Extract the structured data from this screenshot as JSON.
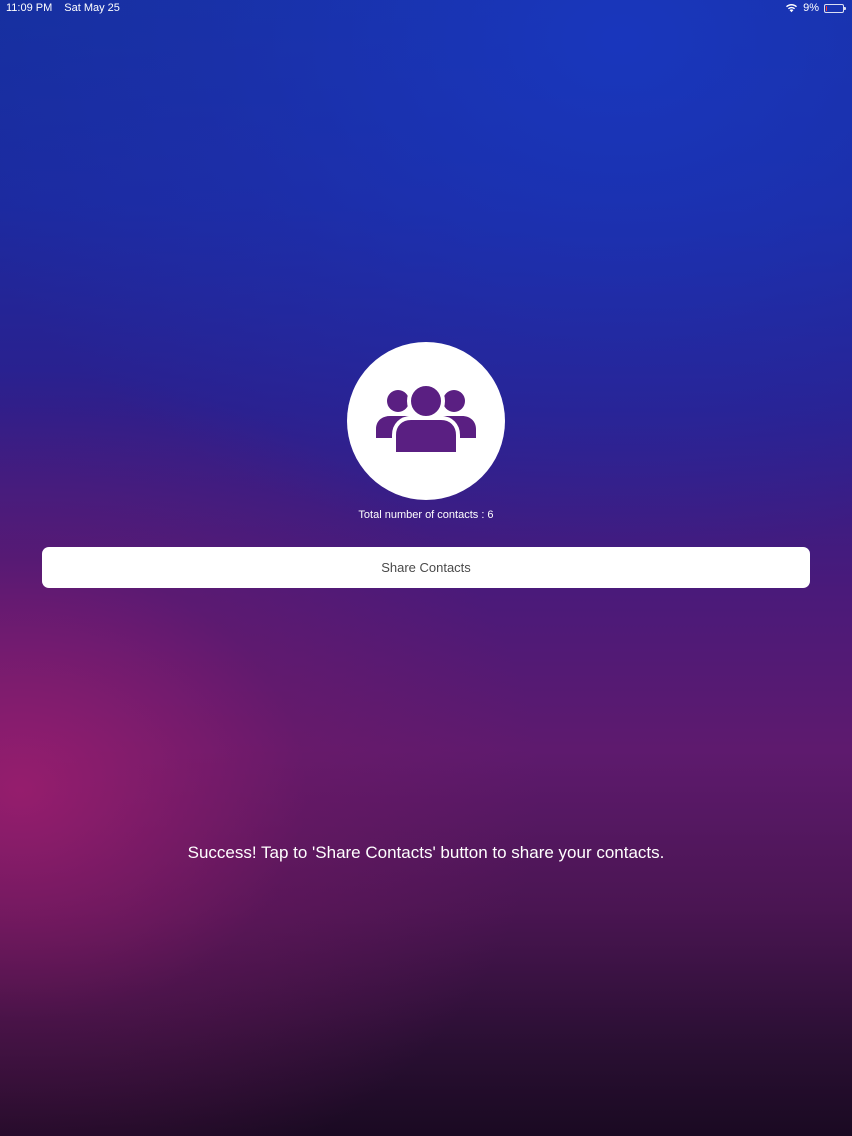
{
  "status_bar": {
    "time": "11:09 PM",
    "date": "Sat May 25",
    "battery_percent": "9%",
    "battery_level": 0.09,
    "battery_color": "#ff3b30",
    "icons": [
      "wifi-icon",
      "battery-icon"
    ]
  },
  "main": {
    "contacts_icon": "contacts-group-icon",
    "count_label": "Total number of contacts : 6",
    "share_button_label": "Share Contacts",
    "message": "Success! Tap to 'Share Contacts' button to share your contacts."
  },
  "colors": {
    "icon_purple": "#5a1f82",
    "button_background": "#ffffff",
    "gradient_top": "#15309e",
    "gradient_bottom": "#1a0a22",
    "accent_magenta": "#a01e6e"
  }
}
